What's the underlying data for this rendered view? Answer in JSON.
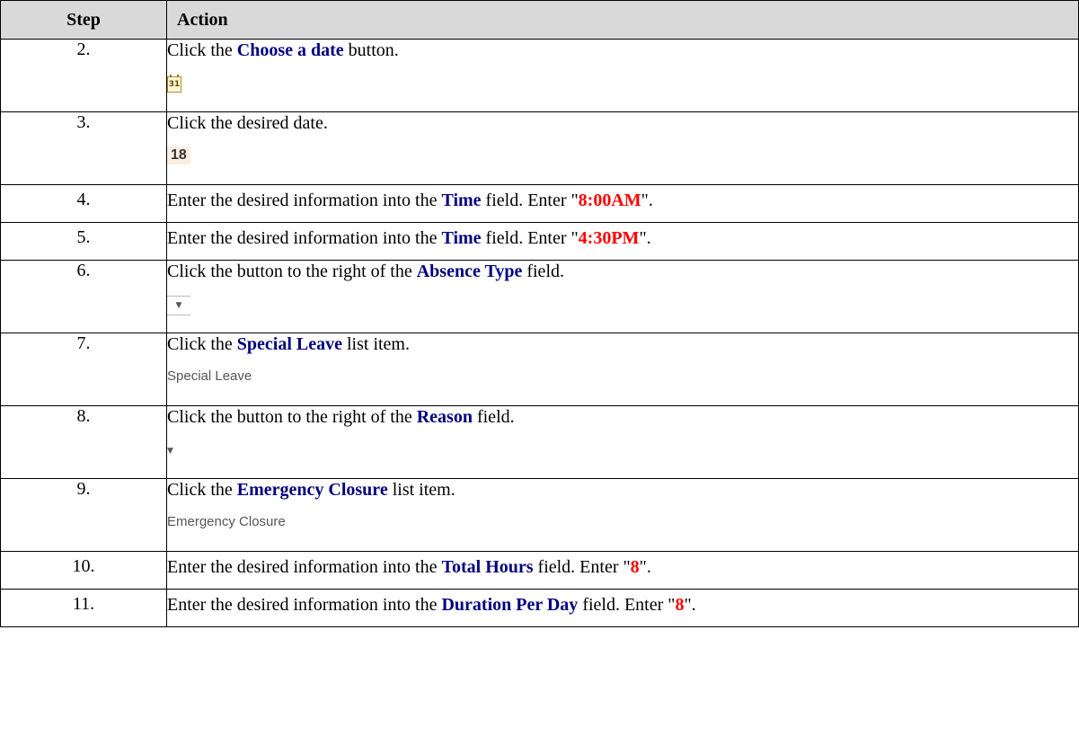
{
  "header": {
    "step": "Step",
    "action": "Action"
  },
  "rows": [
    {
      "step": "2.",
      "pre": "Click the ",
      "kw": "Choose a date",
      "post": " button.",
      "icon": "calendar-icon",
      "icon_text": "31"
    },
    {
      "step": "3.",
      "pre": "Click the desired date.",
      "date_value": "18"
    },
    {
      "step": "4.",
      "pre": "Enter the desired information into the ",
      "kw": "Time",
      "mid": " field. Enter \"",
      "val": "8:00AM",
      "post": "\"."
    },
    {
      "step": "5.",
      "pre": "Enter the desired information into the ",
      "kw": "Time",
      "mid": " field. Enter \"",
      "val": "4:30PM",
      "post": "\"."
    },
    {
      "step": "6.",
      "pre": "Click the button to the right of the ",
      "kw": "Absence Type",
      "post": " field.",
      "icon": "dropdown-arrow-icon",
      "icon_text": "▼"
    },
    {
      "step": "7.",
      "pre": "Click the ",
      "kw": "Special Leave",
      "post": " list item.",
      "item_text": "Special Leave"
    },
    {
      "step": "8.",
      "pre": "Click the button to the right of the ",
      "kw": "Reason",
      "post": " field.",
      "icon": "dropdown-arrow-icon",
      "icon_text": "▼"
    },
    {
      "step": "9.",
      "pre": "Click the ",
      "kw": "Emergency Closure",
      "post": " list item.",
      "item_text": "Emergency Closure"
    },
    {
      "step": "10.",
      "pre": "Enter the desired information into the ",
      "kw": "Total Hours",
      "mid": " field. Enter \"",
      "val": "8",
      "post": "\"."
    },
    {
      "step": "11.",
      "pre": "Enter the desired information into the ",
      "kw": "Duration Per Day",
      "mid": " field. Enter \"",
      "val": "8",
      "post": "\"."
    }
  ],
  "colors": {
    "keyword": "#000080",
    "value": "#ff0000",
    "header_bg": "#d9d9d9"
  }
}
